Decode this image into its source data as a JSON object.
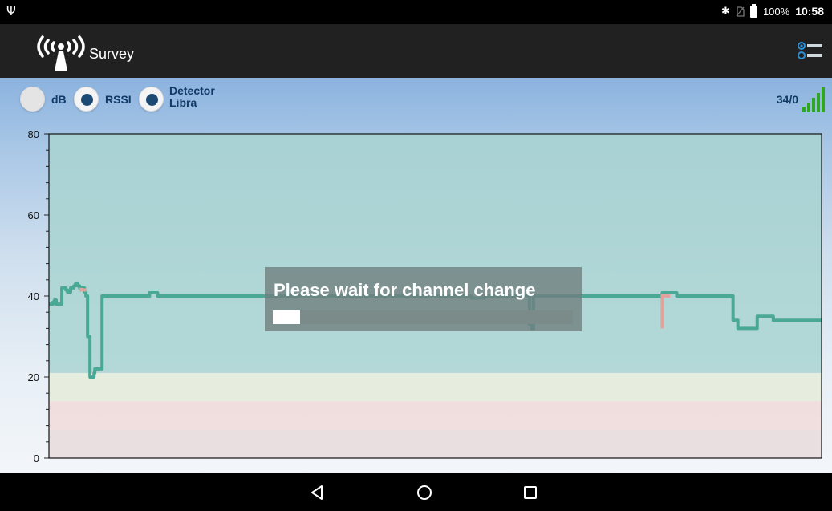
{
  "status_bar": {
    "usb_icon": "usb-icon",
    "bluetooth_icon": "bluetooth-icon",
    "no_sim_icon": "no-sim-icon",
    "battery_icon": "battery-icon",
    "battery_percent": "100%",
    "time": "10:58"
  },
  "app_bar": {
    "logo_icon": "antenna-signal-icon",
    "title": "Survey",
    "menu_icon": "settings-list-icon"
  },
  "controls": {
    "modes": [
      {
        "label": "dB",
        "selected": false
      },
      {
        "label": "RSSI",
        "selected": true
      },
      {
        "label": "Detector",
        "sublabel": "Libra",
        "selected": true
      }
    ],
    "counter": "34/0",
    "signal_icon": "signal-strength-icon"
  },
  "chart_data": {
    "type": "line",
    "ylim": [
      0,
      80
    ],
    "yticks": [
      "0",
      "20",
      "40",
      "60",
      "80"
    ],
    "bands": [
      {
        "from": 21,
        "to": 80,
        "color": "#a9d3d1"
      },
      {
        "from": 14,
        "to": 21,
        "color": "#e6ecd9"
      },
      {
        "from": 7,
        "to": 14,
        "color": "#f1dada"
      },
      {
        "from": 0,
        "to": 7,
        "color": "#e7d9dc"
      }
    ],
    "colors": {
      "line": "#4aa995",
      "highlight": "#e1a39b"
    },
    "x": [
      0,
      4,
      5,
      7,
      9,
      11,
      16,
      17,
      21,
      23,
      26,
      27,
      31,
      33,
      36,
      38,
      41,
      42,
      44,
      46,
      48,
      50,
      51,
      55,
      56,
      57,
      58,
      60,
      62,
      65,
      66,
      70,
      80,
      124,
      125,
      135,
      160,
      280,
      505,
      520,
      525,
      540,
      550,
      590,
      596,
      597,
      600,
      602,
      610,
      625,
      630,
      690,
      760,
      762,
      780,
      830,
      840,
      850,
      856,
      860,
      880,
      900,
      940,
      954,
      960
    ],
    "y": [
      38,
      38,
      38.5,
      39,
      38,
      38,
      42,
      42,
      41.5,
      41,
      41,
      42,
      42.5,
      43,
      42.5,
      42,
      42,
      42,
      41,
      40,
      30,
      30,
      20,
      20,
      21,
      22,
      22,
      22,
      22,
      22,
      40,
      40,
      40,
      40,
      40.8,
      40,
      40,
      40,
      40,
      40,
      39.5,
      40,
      40,
      40,
      40,
      33,
      32,
      40,
      40,
      40,
      40,
      40,
      40,
      40.8,
      40,
      40,
      40,
      34,
      32,
      32,
      35,
      34,
      34,
      34,
      34
    ],
    "highlight_segments": [
      {
        "x": [
          40,
          47
        ],
        "y": [
          42,
          41.5
        ]
      },
      {
        "x": [
          762,
          772
        ],
        "y": [
          32,
          40
        ]
      }
    ]
  },
  "overlay": {
    "message": "Please wait for channel change",
    "progress": 0.09
  },
  "nav_bar": {
    "back_icon": "back-triangle-icon",
    "home_icon": "home-circle-icon",
    "recents_icon": "recents-square-icon"
  }
}
